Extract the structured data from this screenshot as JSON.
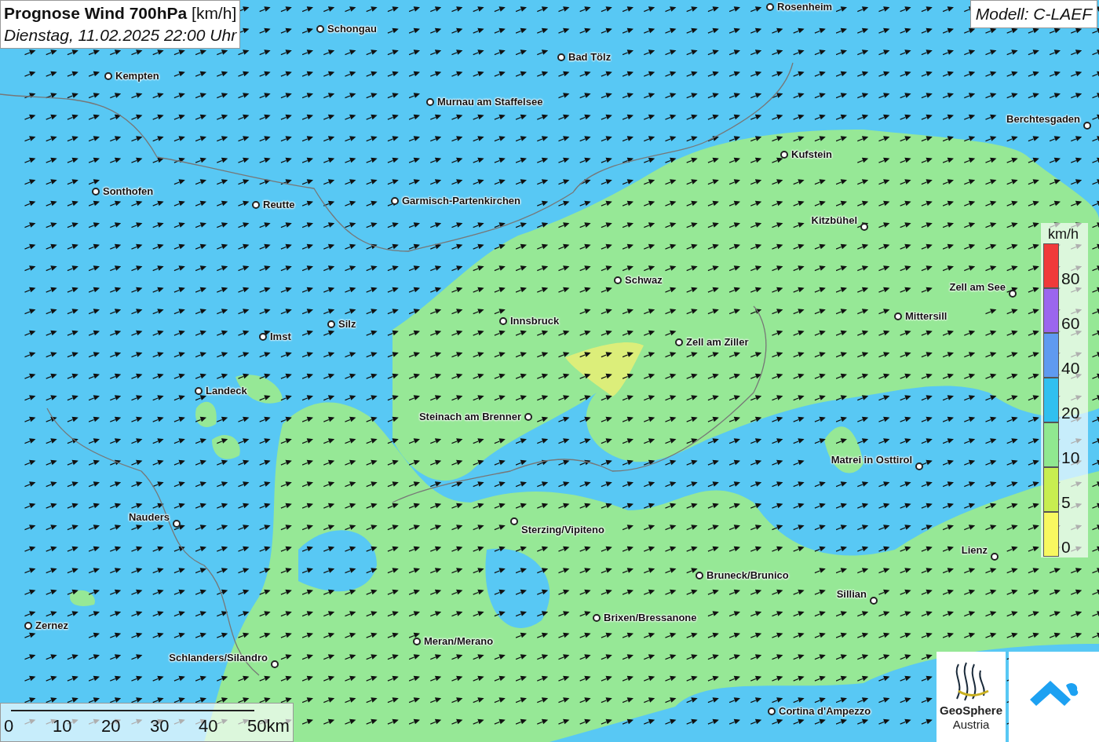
{
  "title": {
    "main": "Prognose Wind 700hPa",
    "unit": "[km/h]",
    "subtitle": "Dienstag, 11.02.2025 22:00 Uhr"
  },
  "model": "Modell: C-LAEF",
  "cities": [
    {
      "name": "Rosenheim"
    },
    {
      "name": "Schongau"
    },
    {
      "name": "Bad Tölz"
    },
    {
      "name": "Kempten"
    },
    {
      "name": "Murnau am Staffelsee"
    },
    {
      "name": "Berchtesgaden"
    },
    {
      "name": "Kufstein"
    },
    {
      "name": "Sonthofen"
    },
    {
      "name": "Reutte"
    },
    {
      "name": "Garmisch-Partenkirchen"
    },
    {
      "name": "Kitzbühel"
    },
    {
      "name": "Schwaz"
    },
    {
      "name": "Zell am See"
    },
    {
      "name": "Mittersill"
    },
    {
      "name": "Silz"
    },
    {
      "name": "Innsbruck"
    },
    {
      "name": "Imst"
    },
    {
      "name": "Zell am Ziller"
    },
    {
      "name": "Landeck"
    },
    {
      "name": "Steinach am Brenner"
    },
    {
      "name": "Matrei in Osttirol"
    },
    {
      "name": "Sterzing/Vipiteno"
    },
    {
      "name": "Nauders"
    },
    {
      "name": "Lienz"
    },
    {
      "name": "Bruneck/Brunico"
    },
    {
      "name": "Sillian"
    },
    {
      "name": "Brixen/Bressanone"
    },
    {
      "name": "Zernez"
    },
    {
      "name": "Meran/Merano"
    },
    {
      "name": "Schlanders/Silandro"
    },
    {
      "name": "Cortina d'Ampezzo"
    }
  ],
  "legend": {
    "unit": "km/h",
    "classes": [
      {
        "label": "80",
        "color": "#f03a3a"
      },
      {
        "label": "60",
        "color": "#9b66ee"
      },
      {
        "label": "40",
        "color": "#5f9af0"
      },
      {
        "label": "20",
        "color": "#30c0f0"
      },
      {
        "label": "10",
        "color": "#90e890"
      },
      {
        "label": "5",
        "color": "#c8ee50"
      },
      {
        "label": "0",
        "color": "#f8f860"
      }
    ]
  },
  "scale": [
    "0",
    "10",
    "20",
    "30",
    "40",
    "50km"
  ],
  "logo": {
    "line1": "GeoSphere",
    "line2": "Austria"
  }
}
